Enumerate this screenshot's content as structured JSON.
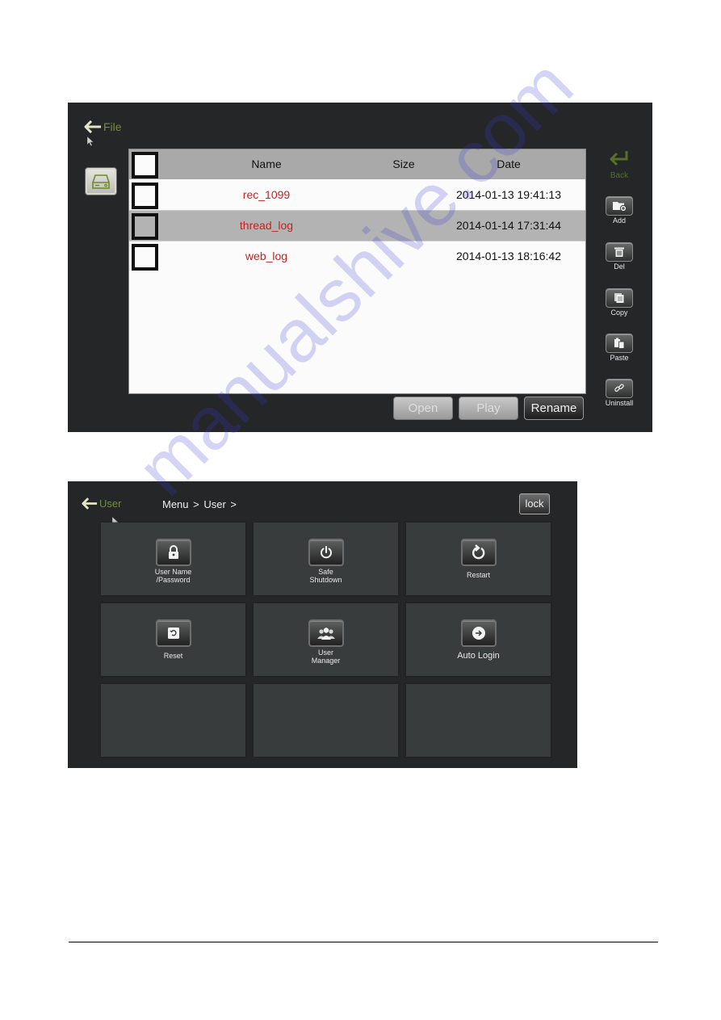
{
  "file_screen": {
    "back_label": "File",
    "table": {
      "headers": {
        "name": "Name",
        "size": "Size",
        "date": "Date"
      },
      "rows": [
        {
          "name": "rec_1099",
          "size": "",
          "date": "2014-01-13 19:41:13",
          "checked": false,
          "highlighted": false
        },
        {
          "name": "thread_log",
          "size": "",
          "date": "2014-01-14 17:31:44",
          "checked": false,
          "highlighted": true
        },
        {
          "name": "web_log",
          "size": "",
          "date": "2014-01-13 18:16:42",
          "checked": false,
          "highlighted": false
        }
      ]
    },
    "side_actions": {
      "back": "Back",
      "add": "Add",
      "del": "Del",
      "copy": "Copy",
      "paste": "Paste",
      "uninstall": "Uninstall"
    },
    "bottom_buttons": {
      "open": "Open",
      "play": "Play",
      "rename": "Rename"
    },
    "colors": {
      "accent_green": "#6f8f33",
      "filename_red": "#cc1f1f",
      "background": "#252628"
    }
  },
  "user_screen": {
    "back_label": "User",
    "breadcrumb": "Menu >  User >",
    "lock_label": "lock",
    "tiles": [
      {
        "label_line1": "User Name",
        "label_line2": "/Password",
        "icon": "lock-icon"
      },
      {
        "label_line1": "Safe",
        "label_line2": "Shutdown",
        "icon": "power-icon"
      },
      {
        "label_line1": "Restart",
        "label_line2": "",
        "icon": "restart-icon"
      },
      {
        "label_line1": "Reset",
        "label_line2": "",
        "icon": "reset-icon"
      },
      {
        "label_line1": "User",
        "label_line2": "Manager",
        "icon": "users-icon"
      },
      {
        "label_line1": "Auto Login",
        "label_line2": "",
        "icon": "arrow-circle-icon"
      },
      {
        "label_line1": "",
        "label_line2": "",
        "icon": ""
      },
      {
        "label_line1": "",
        "label_line2": "",
        "icon": ""
      },
      {
        "label_line1": "",
        "label_line2": "",
        "icon": ""
      }
    ]
  },
  "watermark": "manualshive.com"
}
